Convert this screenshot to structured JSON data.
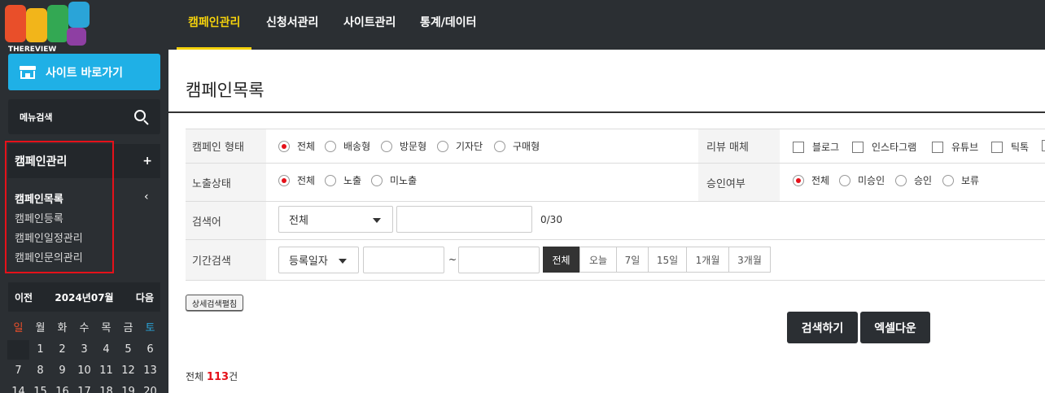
{
  "brand": {
    "name": "THEREVIEW"
  },
  "sidebar": {
    "site_button": "사이트 바로가기",
    "menu_search": "메뉴검색",
    "group": {
      "title": "캠페인관리",
      "plus": "+",
      "items": [
        "캠페인목록",
        "캠페인등록",
        "캠페인일정관리",
        "캠페인문의관리"
      ]
    },
    "calendar": {
      "prev": "이전",
      "month": "2024년07월",
      "next": "다음",
      "weekdays": [
        "일",
        "월",
        "화",
        "수",
        "목",
        "금",
        "토"
      ],
      "weeks": [
        [
          "",
          "1",
          "2",
          "3",
          "4",
          "5",
          "6"
        ],
        [
          "7",
          "8",
          "9",
          "10",
          "11",
          "12",
          "13"
        ],
        [
          "14",
          "15",
          "16",
          "17",
          "18",
          "19",
          "20"
        ]
      ]
    }
  },
  "topnav": {
    "items": [
      "캠페인관리",
      "신청서관리",
      "사이트관리",
      "통계/데이터"
    ]
  },
  "page": {
    "title": "캠페인목록"
  },
  "form": {
    "campaign_type": {
      "label": "캠페인 형태",
      "options": [
        "전체",
        "배송형",
        "방문형",
        "기자단",
        "구매형"
      ],
      "selected": "전체"
    },
    "review_media": {
      "label": "리뷰 매체",
      "options": [
        "블로그",
        "인스타그램",
        "유튜브",
        "틱톡"
      ]
    },
    "exposure": {
      "label": "노출상태",
      "options": [
        "전체",
        "노출",
        "미노출"
      ],
      "selected": "전체"
    },
    "approval": {
      "label": "승인여부",
      "options": [
        "전체",
        "미승인",
        "승인",
        "보류"
      ],
      "selected": "전체"
    },
    "keyword": {
      "label": "검색어",
      "select_value": "전체",
      "input_value": "",
      "counter": "0/30"
    },
    "period": {
      "label": "기간검색",
      "select_value": "등록일자",
      "tilde": "~",
      "ranges": [
        "전체",
        "오늘",
        "7일",
        "15일",
        "1개월",
        "3개월"
      ],
      "selected": "전체"
    }
  },
  "buttons": {
    "detail": "상세검색펼침",
    "search": "검색하기",
    "excel": "엑셀다운"
  },
  "summary": {
    "prefix": "전체",
    "count": "113",
    "suffix": "건"
  },
  "colors": {
    "dark": "#2b2f33",
    "accent_yellow": "#f5d20c",
    "accent_blue": "#1fb0e6",
    "accent_red": "#e5111a"
  }
}
